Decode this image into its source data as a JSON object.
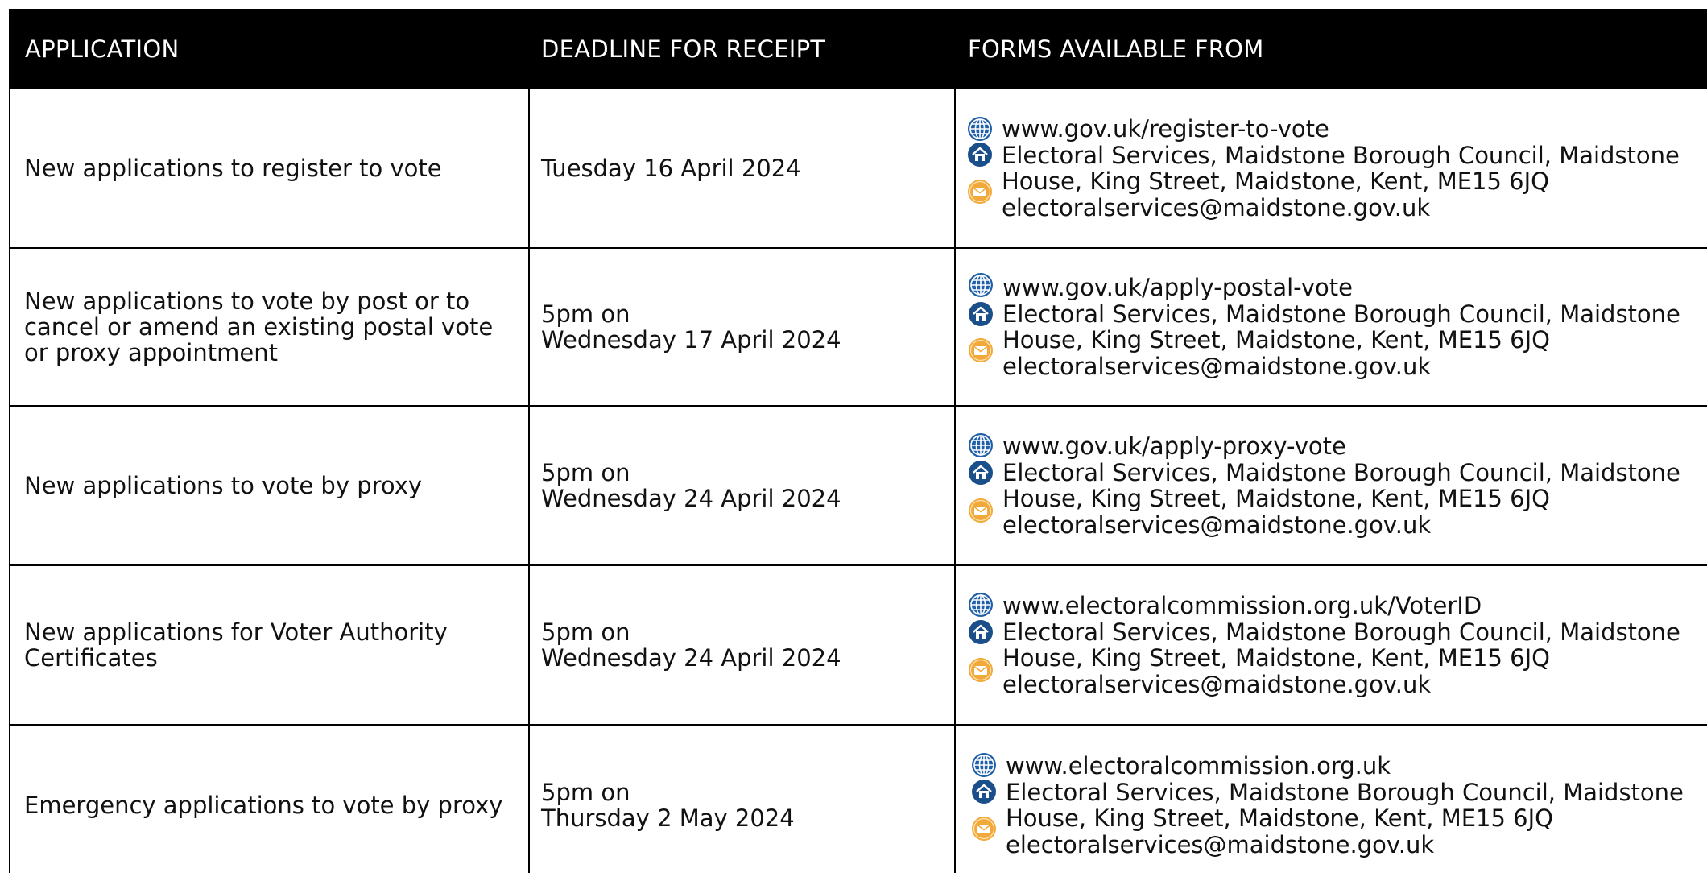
{
  "header": {
    "application": "APPLICATION",
    "deadline": "DEADLINE FOR RECEIPT",
    "forms": "FORMS AVAILABLE FROM"
  },
  "rows": [
    {
      "application": "New applications to register to vote",
      "deadline": "Tuesday 16 April 2024",
      "url": "www.gov.uk/register-to-vote",
      "address": "Electoral Services, Maidstone Borough Council, Maidstone\nHouse, King Street, Maidstone, Kent, ME15 6JQ",
      "email": "electoralservices@maidstone.gov.uk"
    },
    {
      "application": "New applications to vote by post or to\ncancel or amend an existing postal vote\nor proxy appointment",
      "deadline": "5pm on\nWednesday 17 April 2024",
      "url": "www.gov.uk/apply-postal-vote",
      "address": "Electoral Services, Maidstone Borough Council, Maidstone\nHouse, King Street, Maidstone, Kent, ME15 6JQ",
      "email": "electoralservices@maidstone.gov.uk"
    },
    {
      "application": "New applications to vote by proxy",
      "deadline": "5pm on\nWednesday 24 April 2024",
      "url": "www.gov.uk/apply-proxy-vote",
      "address": "Electoral Services, Maidstone Borough Council, Maidstone\nHouse, King Street, Maidstone, Kent, ME15 6JQ",
      "email": "electoralservices@maidstone.gov.uk"
    },
    {
      "application": "New applications for Voter Authority\nCertificates",
      "deadline": "5pm on\nWednesday 24 April 2024",
      "url": "www.electoralcommission.org.uk/VoterID",
      "address": "Electoral Services, Maidstone Borough Council, Maidstone\nHouse, King Street, Maidstone, Kent, ME15 6JQ",
      "email": "electoralservices@maidstone.gov.uk"
    },
    {
      "application": "Emergency applications to vote by proxy",
      "deadline": "5pm on\nThursday 2 May 2024",
      "url": "www.electoralcommission.org.uk",
      "address": "Electoral Services, Maidstone Borough Council, Maidstone\nHouse, King Street, Maidstone, Kent, ME15 6JQ",
      "email": "electoralservices@maidstone.gov.uk"
    }
  ],
  "icons": {
    "web": "globe-icon",
    "address": "house-icon",
    "email": "envelope-icon"
  },
  "colors": {
    "header_bg": "#000000",
    "header_text": "#ffffff",
    "globe": "#1f5fa8",
    "house": "#1b4f8a",
    "envelope": "#f2a93b"
  }
}
